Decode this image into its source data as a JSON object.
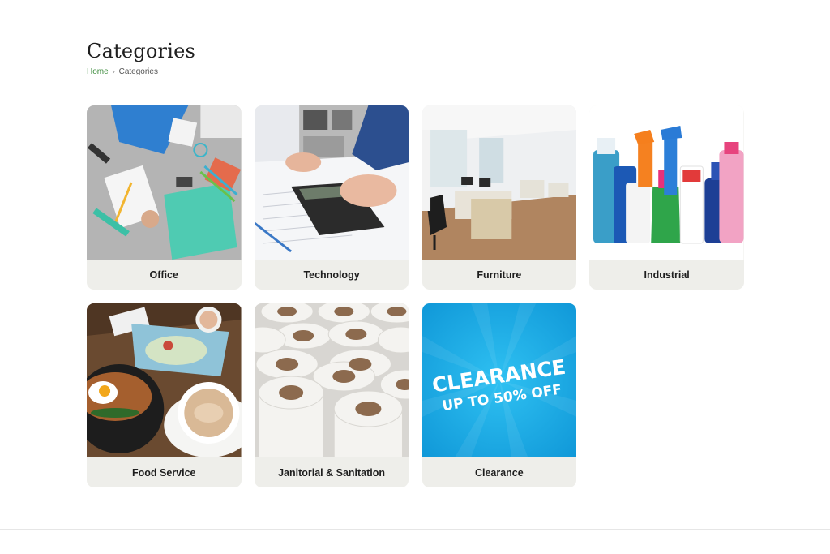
{
  "page": {
    "title": "Categories"
  },
  "breadcrumb": {
    "home": "Home",
    "separator": "›",
    "current": "Categories"
  },
  "categories": [
    {
      "label": "Office",
      "image": "office-supplies-photo"
    },
    {
      "label": "Technology",
      "image": "calculator-desk-photo"
    },
    {
      "label": "Furniture",
      "image": "open-office-photo"
    },
    {
      "label": "Industrial",
      "image": "cleaning-bottles-photo"
    },
    {
      "label": "Food Service",
      "image": "breakfast-table-photo"
    },
    {
      "label": "Janitorial & Sanitation",
      "image": "paper-rolls-photo"
    },
    {
      "label": "Clearance",
      "image": "clearance-banner",
      "banner": {
        "line1": "CLEARANCE",
        "line2": "UP TO 50% OFF"
      }
    }
  ],
  "colors": {
    "link": "#3a8a3a",
    "card_bg": "#eeeeea",
    "clearance_blue": "#19a9e6"
  }
}
